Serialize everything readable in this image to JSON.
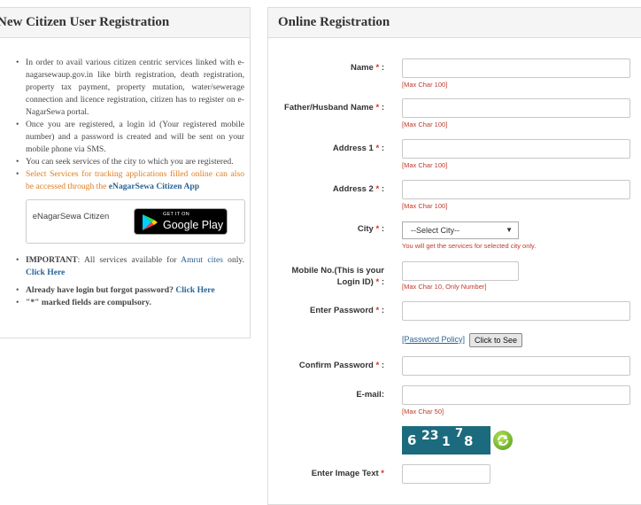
{
  "left_panel": {
    "title": "New Citizen User Registration",
    "bullets": [
      "In order to avail various citizen centric services linked with e-nagarsewaup.gov.in like birth registration, death registration, property tax payment, property mutation, water/sewerage connection and licence registration, citizen has to register on e-NagarSewa portal.",
      "Once you are registered, a login id (Your registered mobile number) and a password is created and will be sent on your mobile phone via SMS.",
      "You can seek services of the city to which you are registered."
    ],
    "orange_bullet": "Select Services for tracking applications filled online can also be accessed through the ",
    "orange_link": "eNagarSewa Citizen App",
    "app_label": "eNagarSewa Citizen",
    "gplay_small": "GET IT ON",
    "gplay_big": "Google Play",
    "important_label": "IMPORTANT",
    "important_text": ": All services available for ",
    "amrut_link": "Amrut cites",
    "important_tail": " only. ",
    "click_here": "Click Here",
    "forgot_text": "Already have login but forgot password? ",
    "forgot_link": "Click Here",
    "compulsory": "\"*\" marked fields are compulsory."
  },
  "right_panel": {
    "title": "Online Registration",
    "fields": {
      "name": {
        "label": "Name",
        "hint": "[Max Char 100]",
        "value": ""
      },
      "father": {
        "label": "Father/Husband Name",
        "hint": "[Max Char 100]",
        "value": ""
      },
      "address1": {
        "label": "Address 1",
        "hint": "[Max Char 100]",
        "value": ""
      },
      "address2": {
        "label": "Address 2",
        "hint": "[Max Char 100]",
        "value": ""
      },
      "city": {
        "label": "City",
        "selected": "--Select City--",
        "hint": "You will get the services for selected city only."
      },
      "mobile": {
        "label_line1": "Mobile No.(This is your",
        "label_line2": "Login ID)",
        "hint": "[Max Char 10, Only Number]",
        "value": ""
      },
      "password": {
        "label": "Enter Password",
        "value": ""
      },
      "confirm": {
        "label": "Confirm Password",
        "value": ""
      },
      "email": {
        "label": "E-mail:",
        "hint": "[Max Char 50]",
        "value": ""
      },
      "image_text": {
        "label": "Enter Image Text",
        "value": ""
      }
    },
    "required_mark": "*",
    "colon": ":",
    "policy_link": "[Password Policy]",
    "see_button": "Click to See",
    "captcha_digits": [
      "6",
      "23",
      "1",
      "7",
      "8"
    ]
  }
}
